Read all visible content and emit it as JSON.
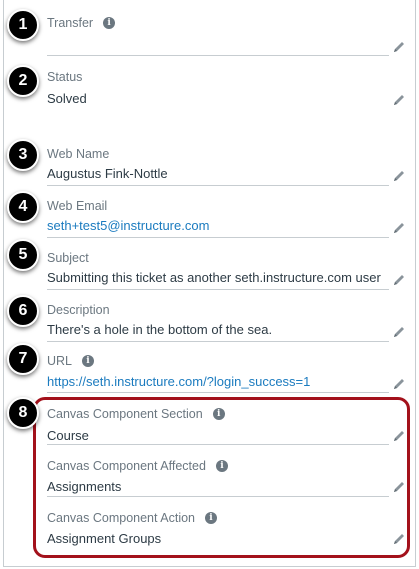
{
  "fields": [
    {
      "id": "transfer",
      "label": "Transfer",
      "value": "",
      "has_info": true
    },
    {
      "id": "status",
      "label": "Status",
      "value": "Solved",
      "has_info": false
    },
    {
      "id": "web-name",
      "label": "Web Name",
      "value": "Augustus Fink-Nottle",
      "has_info": false
    },
    {
      "id": "web-email",
      "label": "Web Email",
      "value": "seth+test5@instructure.com",
      "has_info": false
    },
    {
      "id": "subject",
      "label": "Subject",
      "value": "Submitting this ticket as another seth.instructure.com user",
      "has_info": false
    },
    {
      "id": "description",
      "label": "Description",
      "value": "There's a hole in the bottom of the sea.",
      "has_info": false
    },
    {
      "id": "url",
      "label": "URL",
      "value": "https://seth.instructure.com/?login_success=1",
      "has_info": true
    },
    {
      "id": "canvas-component-section",
      "label": "Canvas Component Section",
      "value": "Course",
      "has_info": true
    },
    {
      "id": "canvas-component-affected",
      "label": "Canvas Component Affected",
      "value": "Assignments",
      "has_info": true
    },
    {
      "id": "canvas-component-action",
      "label": "Canvas Component Action",
      "value": "Assignment Groups",
      "has_info": true
    }
  ],
  "badges": [
    "1",
    "2",
    "3",
    "4",
    "5",
    "6",
    "7",
    "8"
  ],
  "info_glyph": "i",
  "colors": {
    "label": "#6b7780",
    "value": "#2d3b45",
    "link": "#1b7bbf",
    "highlight": "#a3111b",
    "badge": "#000000"
  },
  "icons": {
    "edit": "pencil-icon",
    "info": "info-icon"
  }
}
